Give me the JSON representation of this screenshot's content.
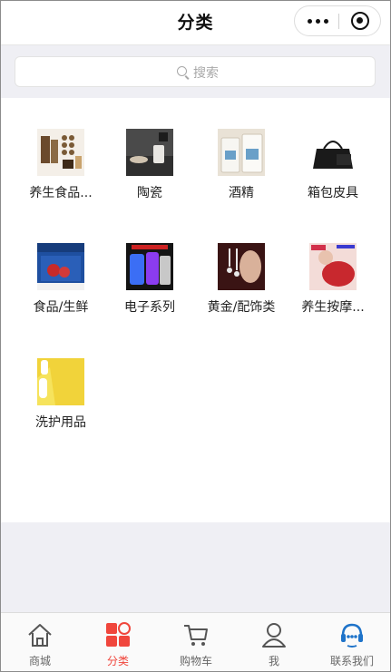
{
  "header": {
    "title": "分类"
  },
  "search": {
    "placeholder": "搜索"
  },
  "categories": [
    {
      "label": "养生食品..."
    },
    {
      "label": "陶瓷"
    },
    {
      "label": "酒精"
    },
    {
      "label": "箱包皮具"
    },
    {
      "label": "食品/生鲜"
    },
    {
      "label": "电子系列"
    },
    {
      "label": "黄金/配饰类"
    },
    {
      "label": "养生按摩..."
    },
    {
      "label": "洗护用品"
    }
  ],
  "tabbar": {
    "items": [
      {
        "label": "商城",
        "icon": "home-icon"
      },
      {
        "label": "分类",
        "icon": "category-icon"
      },
      {
        "label": "购物车",
        "icon": "cart-icon"
      },
      {
        "label": "我",
        "icon": "user-icon"
      },
      {
        "label": "联系我们",
        "icon": "service-icon"
      }
    ],
    "active_index": 1,
    "active_color": "#f0463c",
    "inactive_color": "#666666"
  }
}
